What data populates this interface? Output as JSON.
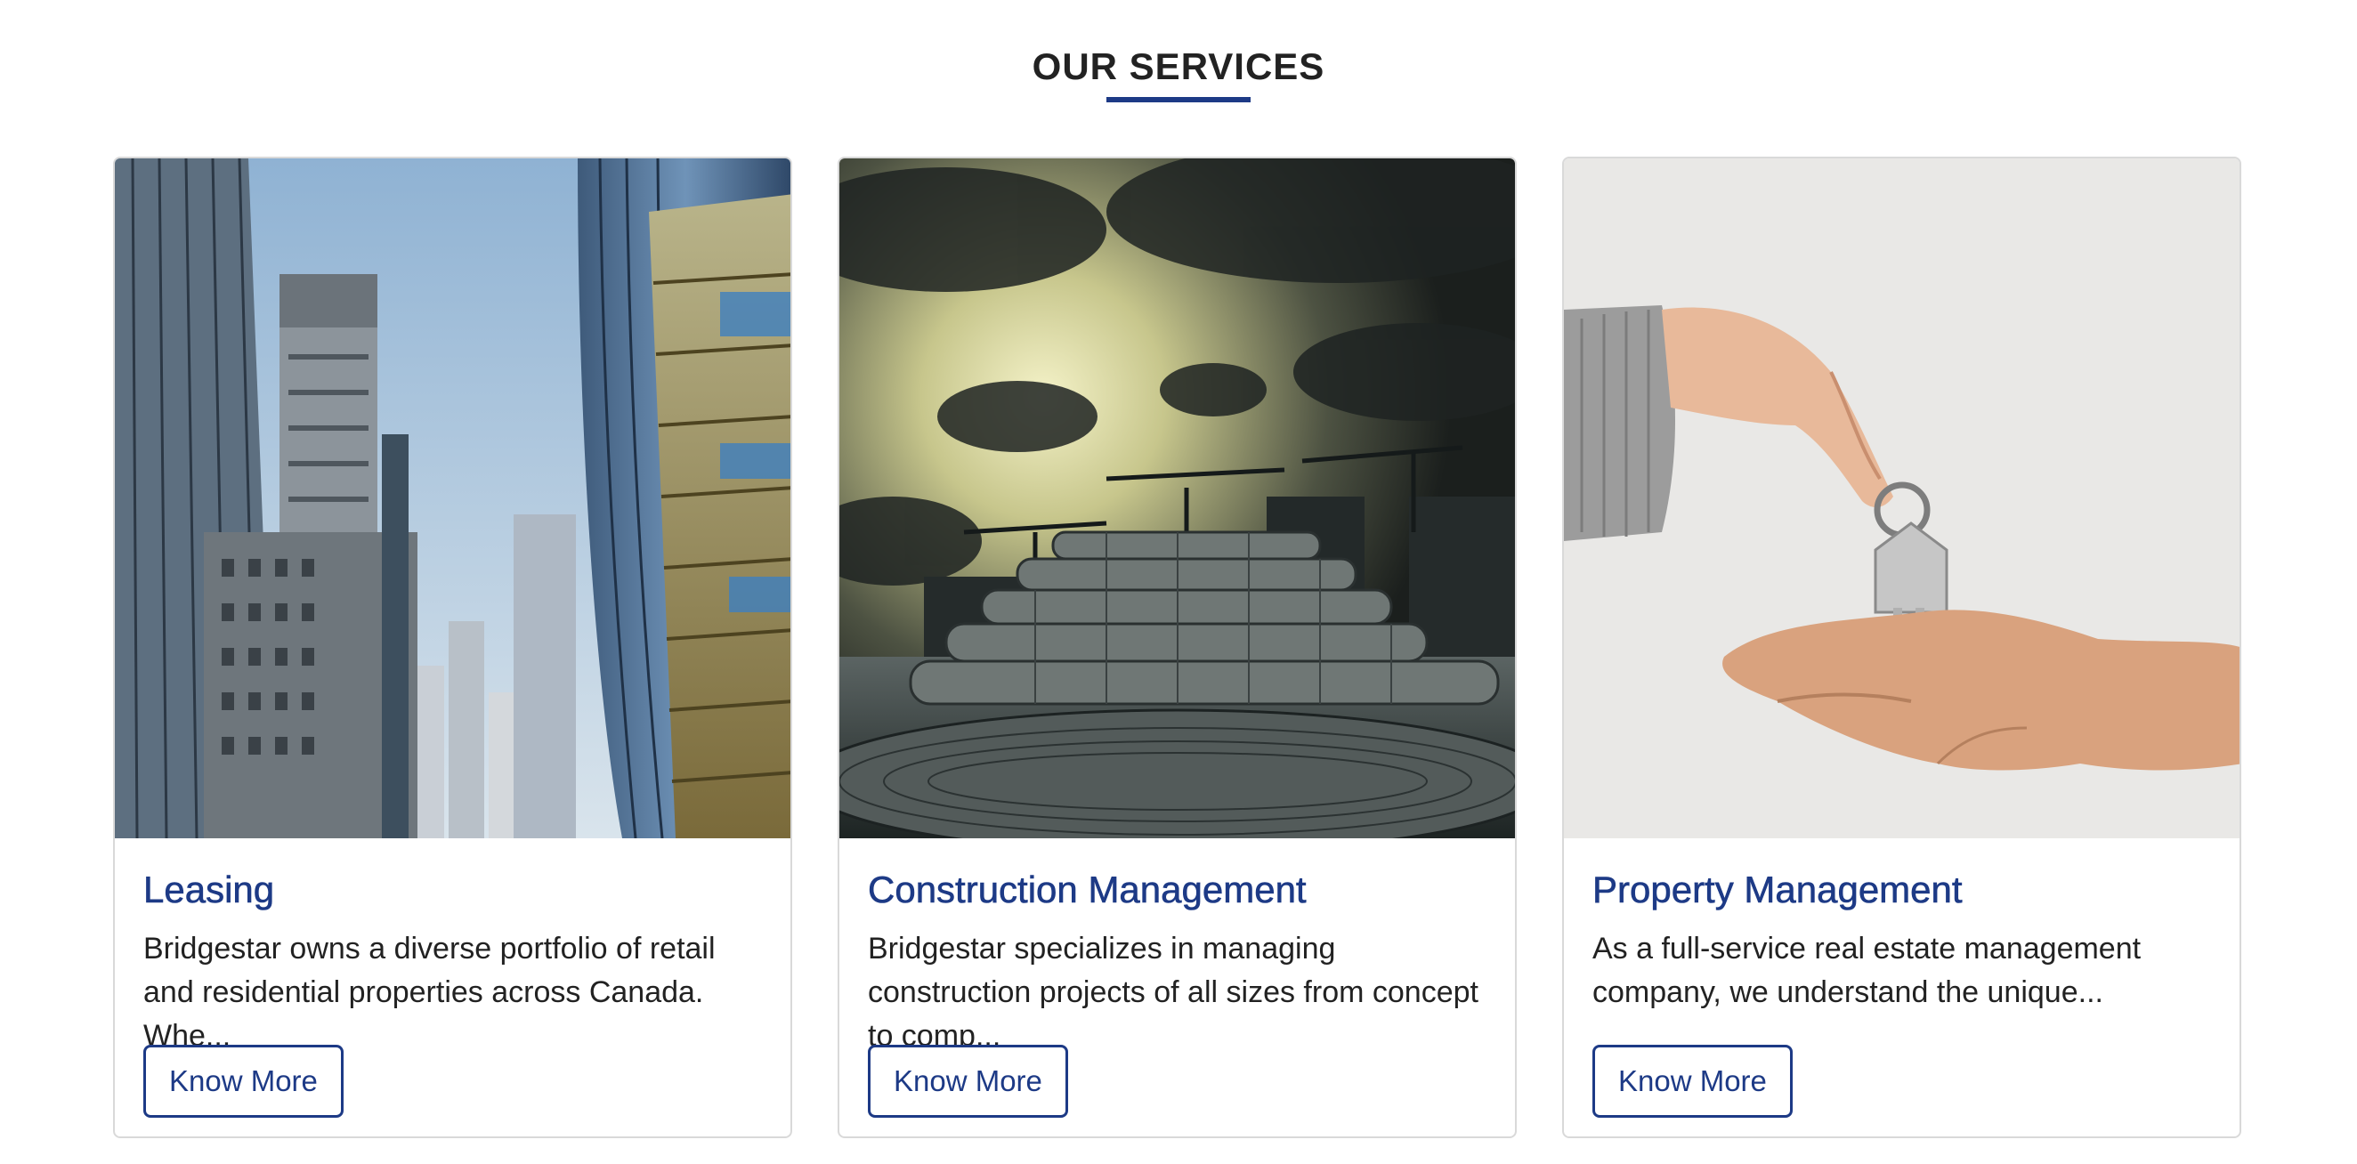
{
  "section": {
    "title": "OUR SERVICES"
  },
  "colors": {
    "accent": "#1d3a86",
    "border": "#d9d9d9",
    "text": "#222222"
  },
  "cards": [
    {
      "image": "city-skyscrapers-photo",
      "title": "Leasing",
      "text": "Bridgestar owns a diverse portfolio of retail and residential properties across Canada. Whe...",
      "button": "Know More"
    },
    {
      "image": "construction-site-steel-coils-photo",
      "title": "Construction Management",
      "text": "Bridgestar specializes in managing construction projects of all sizes from concept to comp...",
      "button": "Know More"
    },
    {
      "image": "hand-over-house-keys-photo",
      "title": "Property Management",
      "text": "As a full-service real estate management company, we understand the unique...",
      "button": "Know More"
    }
  ]
}
